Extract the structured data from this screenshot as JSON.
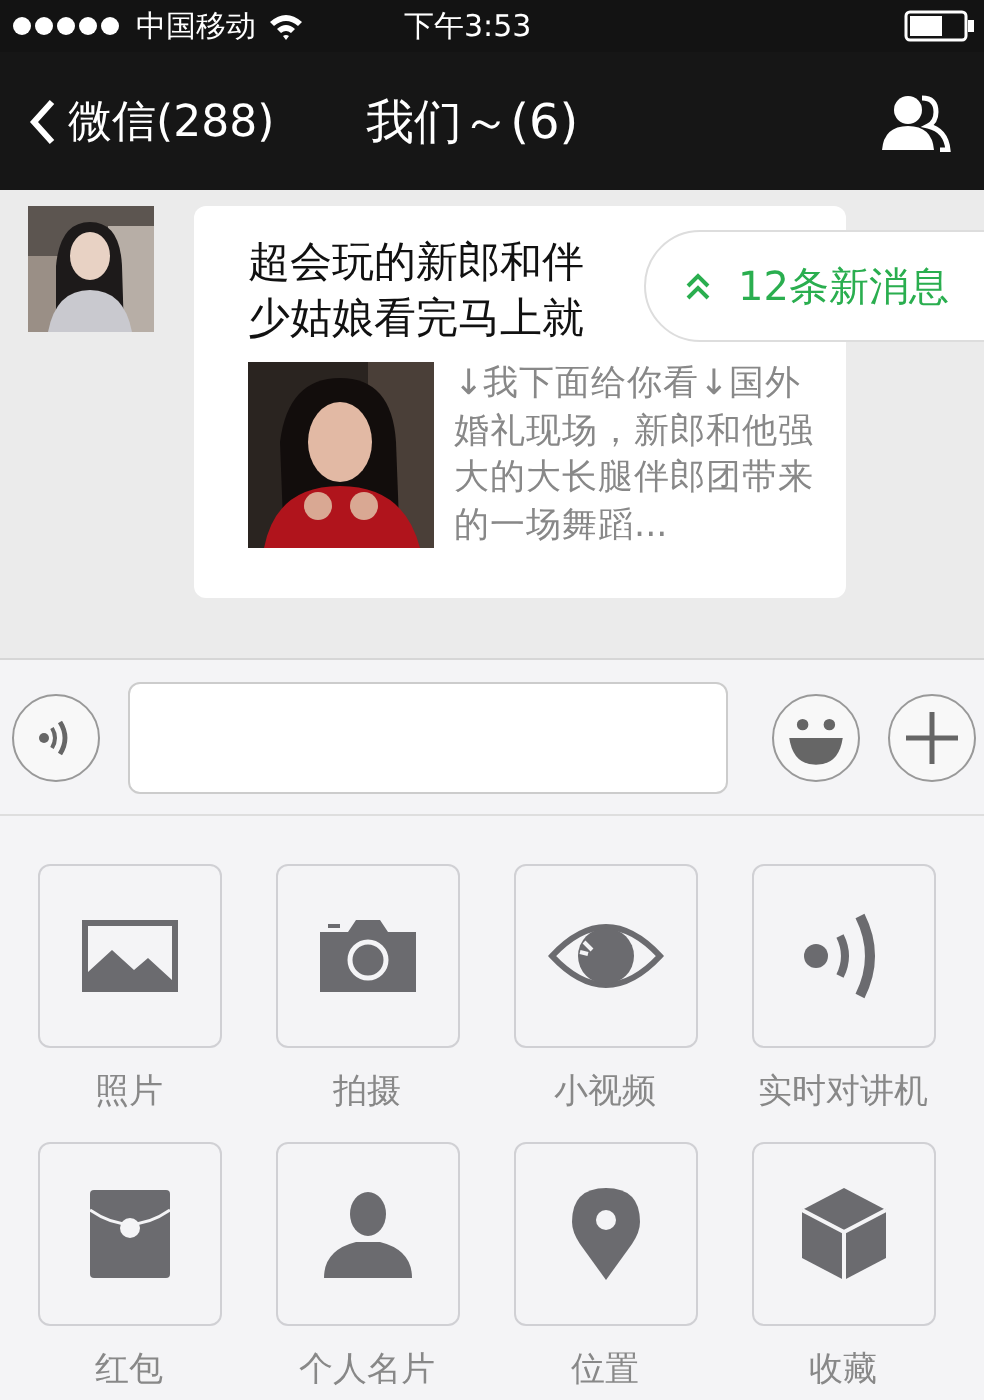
{
  "status_bar": {
    "carrier": "中国移动",
    "time": "下午3:53"
  },
  "nav": {
    "back_label": "微信(288)",
    "title": "我们～(6)"
  },
  "message": {
    "title_lines": [
      "超会玩的新郎和伴",
      "少姑娘看完马上就"
    ],
    "description": "↓我下面给你看↓国外婚礼现场，新郎和他强大的大长腿伴郎团带来的一场舞蹈..."
  },
  "new_messages": "12条新消息",
  "panel": [
    {
      "label": "照片"
    },
    {
      "kind": "camera",
      "label": "拍摄"
    },
    {
      "kind": "video",
      "label": "小视频"
    },
    {
      "kind": "walkie",
      "label": "实时对讲机"
    },
    {
      "kind": "packet",
      "label": "红包"
    },
    {
      "kind": "card",
      "label": "个人名片"
    },
    {
      "kind": "location",
      "label": "位置"
    },
    {
      "kind": "favorites",
      "label": "收藏"
    }
  ]
}
